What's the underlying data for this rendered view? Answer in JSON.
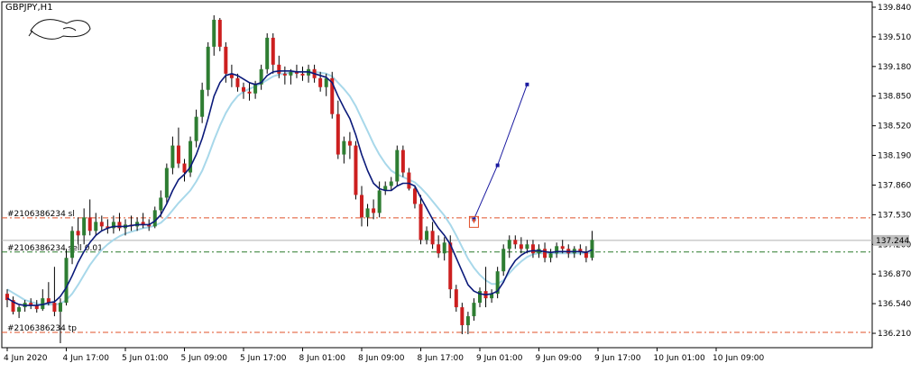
{
  "window": {
    "symbol_title": "GBPJPY,H1"
  },
  "colors": {
    "background": "#ffffff",
    "grid_frame": "#000000",
    "bull_candle": "#2e7d32",
    "bear_candle": "#cc1f1f",
    "fast_ma": "#0b1a7a",
    "slow_ma": "#a8d8ea",
    "order_sl_tp_line": "#e0502a",
    "order_entry_line": "#2a7a2a",
    "bid_line": "#b0b0b0",
    "price_label_bg": "#c0c0c0",
    "forecast_line": "#1a1aa0"
  },
  "chart_data": {
    "type": "candlestick",
    "title": "GBPJPY,H1",
    "ylim": [
      136.05,
      139.9
    ],
    "y_ticks": [
      "139.840",
      "139.510",
      "139.180",
      "138.850",
      "138.520",
      "138.190",
      "137.860",
      "137.530",
      "137.200",
      "136.870",
      "136.540",
      "136.210"
    ],
    "y_tick_values": [
      139.84,
      139.51,
      139.18,
      138.85,
      138.52,
      138.19,
      137.86,
      137.53,
      137.2,
      136.87,
      136.54,
      136.21
    ],
    "x_ticks": [
      "4 Jun 2020",
      "4 Jun 17:00",
      "5 Jun 01:00",
      "5 Jun 09:00",
      "5 Jun 17:00",
      "8 Jun 01:00",
      "8 Jun 09:00",
      "8 Jun 17:00",
      "9 Jun 01:00",
      "9 Jun 09:00",
      "9 Jun 17:00",
      "10 Jun 01:00",
      "10 Jun 09:00"
    ],
    "x_tick_bar_index": [
      0,
      10,
      20,
      30,
      40,
      50,
      60,
      70,
      80,
      90,
      100,
      110,
      120
    ],
    "current_price": 137.244,
    "current_price_label": "137.244",
    "horizontal_lines": [
      {
        "label": "#2106386234 sl",
        "value": 137.495,
        "kind": "sl"
      },
      {
        "label": "#2106386234 sell 0.01",
        "value": 137.115,
        "kind": "entry"
      },
      {
        "label": "#2106386234 tp",
        "value": 136.22,
        "kind": "tp"
      }
    ],
    "ohlc": [
      [
        136.65,
        136.7,
        136.5,
        136.58
      ],
      [
        136.58,
        136.62,
        136.42,
        136.45
      ],
      [
        136.45,
        136.52,
        136.38,
        136.5
      ],
      [
        136.5,
        136.58,
        136.45,
        136.55
      ],
      [
        136.55,
        136.6,
        136.48,
        136.52
      ],
      [
        136.52,
        136.58,
        136.44,
        136.48
      ],
      [
        136.48,
        136.7,
        136.46,
        136.6
      ],
      [
        136.6,
        136.78,
        136.52,
        136.55
      ],
      [
        136.55,
        136.95,
        136.4,
        136.45
      ],
      [
        136.45,
        136.6,
        136.1,
        136.55
      ],
      [
        136.55,
        137.15,
        136.52,
        137.05
      ],
      [
        137.05,
        137.4,
        136.98,
        137.35
      ],
      [
        137.35,
        137.5,
        137.2,
        137.3
      ],
      [
        137.3,
        137.6,
        137.2,
        137.5
      ],
      [
        137.5,
        137.7,
        137.3,
        137.35
      ],
      [
        137.35,
        137.55,
        137.3,
        137.45
      ],
      [
        137.45,
        137.52,
        137.35,
        137.4
      ],
      [
        137.4,
        137.48,
        137.32,
        137.38
      ],
      [
        137.38,
        137.52,
        137.32,
        137.45
      ],
      [
        137.45,
        137.55,
        137.35,
        137.38
      ],
      [
        137.38,
        137.48,
        137.3,
        137.42
      ],
      [
        137.42,
        137.52,
        137.35,
        137.4
      ],
      [
        137.4,
        137.5,
        137.35,
        137.45
      ],
      [
        137.45,
        137.55,
        137.38,
        137.42
      ],
      [
        137.42,
        137.48,
        137.35,
        137.4
      ],
      [
        137.4,
        137.62,
        137.38,
        137.58
      ],
      [
        137.58,
        137.8,
        137.5,
        137.72
      ],
      [
        137.72,
        138.1,
        137.65,
        138.05
      ],
      [
        138.05,
        138.4,
        137.98,
        138.3
      ],
      [
        138.3,
        138.5,
        138.05,
        138.1
      ],
      [
        138.1,
        138.15,
        137.9,
        138.0
      ],
      [
        138.0,
        138.4,
        137.95,
        138.35
      ],
      [
        138.35,
        138.7,
        138.28,
        138.62
      ],
      [
        138.62,
        139.0,
        138.55,
        138.92
      ],
      [
        138.92,
        139.45,
        138.85,
        139.4
      ],
      [
        139.4,
        139.75,
        139.3,
        139.7
      ],
      [
        139.7,
        139.72,
        139.35,
        139.4
      ],
      [
        139.4,
        139.45,
        139.0,
        139.1
      ],
      [
        139.1,
        139.2,
        138.95,
        139.05
      ],
      [
        139.05,
        139.1,
        138.9,
        138.95
      ],
      [
        138.95,
        139.0,
        138.82,
        138.9
      ],
      [
        138.9,
        139.0,
        138.8,
        138.88
      ],
      [
        138.88,
        139.02,
        138.82,
        138.98
      ],
      [
        138.98,
        139.2,
        138.92,
        139.15
      ],
      [
        139.15,
        139.55,
        139.1,
        139.5
      ],
      [
        139.5,
        139.55,
        139.1,
        139.2
      ],
      [
        139.2,
        139.3,
        139.05,
        139.1
      ],
      [
        139.1,
        139.18,
        138.98,
        139.08
      ],
      [
        139.08,
        139.15,
        138.98,
        139.12
      ],
      [
        139.12,
        139.2,
        139.05,
        139.1
      ],
      [
        139.1,
        139.18,
        139.02,
        139.08
      ],
      [
        139.08,
        139.2,
        139.0,
        139.15
      ],
      [
        139.15,
        139.2,
        139.0,
        139.05
      ],
      [
        139.05,
        139.12,
        138.9,
        138.95
      ],
      [
        138.95,
        139.1,
        138.85,
        139.05
      ],
      [
        139.05,
        139.12,
        138.6,
        138.65
      ],
      [
        138.65,
        138.8,
        138.15,
        138.2
      ],
      [
        138.2,
        138.4,
        138.1,
        138.35
      ],
      [
        138.35,
        138.45,
        138.15,
        138.3
      ],
      [
        138.3,
        138.35,
        137.7,
        137.75
      ],
      [
        137.75,
        137.85,
        137.4,
        137.5
      ],
      [
        137.5,
        137.65,
        137.4,
        137.6
      ],
      [
        137.6,
        137.7,
        137.48,
        137.55
      ],
      [
        137.55,
        137.9,
        137.5,
        137.8
      ],
      [
        137.8,
        137.9,
        137.75,
        137.85
      ],
      [
        137.85,
        137.95,
        137.8,
        137.9
      ],
      [
        137.9,
        138.3,
        137.85,
        138.25
      ],
      [
        138.25,
        138.3,
        137.95,
        138.0
      ],
      [
        138.0,
        138.05,
        137.8,
        137.82
      ],
      [
        137.82,
        137.85,
        137.6,
        137.65
      ],
      [
        137.65,
        137.75,
        137.2,
        137.25
      ],
      [
        137.25,
        137.4,
        137.2,
        137.35
      ],
      [
        137.35,
        137.45,
        137.15,
        137.2
      ],
      [
        137.2,
        137.3,
        137.05,
        137.1
      ],
      [
        137.1,
        137.28,
        137.02,
        137.22
      ],
      [
        137.22,
        137.3,
        136.6,
        136.7
      ],
      [
        136.7,
        136.75,
        136.45,
        136.5
      ],
      [
        136.5,
        136.55,
        136.2,
        136.3
      ],
      [
        136.3,
        136.45,
        136.2,
        136.4
      ],
      [
        136.4,
        136.6,
        136.35,
        136.55
      ],
      [
        136.55,
        136.72,
        136.5,
        136.68
      ],
      [
        136.68,
        136.95,
        136.5,
        136.6
      ],
      [
        136.6,
        136.7,
        136.55,
        136.65
      ],
      [
        136.65,
        136.95,
        136.6,
        136.9
      ],
      [
        136.9,
        137.2,
        136.85,
        137.15
      ],
      [
        137.15,
        137.3,
        137.05,
        137.25
      ],
      [
        137.25,
        137.3,
        137.15,
        137.2
      ],
      [
        137.2,
        137.28,
        137.1,
        137.15
      ],
      [
        137.15,
        137.25,
        137.1,
        137.2
      ],
      [
        137.2,
        137.25,
        137.05,
        137.1
      ],
      [
        137.1,
        137.2,
        137.05,
        137.15
      ],
      [
        137.15,
        137.22,
        137.0,
        137.05
      ],
      [
        137.05,
        137.15,
        137.0,
        137.1
      ],
      [
        137.1,
        137.22,
        137.05,
        137.18
      ],
      [
        137.18,
        137.25,
        137.1,
        137.15
      ],
      [
        137.15,
        137.2,
        137.05,
        137.1
      ],
      [
        137.1,
        137.18,
        137.05,
        137.15
      ],
      [
        137.15,
        137.2,
        137.08,
        137.12
      ],
      [
        137.12,
        137.18,
        137.0,
        137.05
      ],
      [
        137.05,
        137.35,
        137.02,
        137.25
      ]
    ],
    "fast_ma": [
      136.6,
      136.56,
      136.53,
      136.52,
      136.52,
      136.52,
      136.53,
      136.55,
      136.56,
      136.62,
      136.72,
      136.85,
      137.0,
      137.12,
      137.22,
      137.3,
      137.35,
      137.38,
      137.4,
      137.4,
      137.4,
      137.41,
      137.42,
      137.42,
      137.42,
      137.46,
      137.53,
      137.65,
      137.8,
      137.92,
      137.98,
      138.06,
      138.2,
      138.38,
      138.6,
      138.85,
      139.0,
      139.08,
      139.1,
      139.08,
      139.04,
      139.0,
      138.98,
      139.0,
      139.08,
      139.12,
      139.13,
      139.13,
      139.13,
      139.12,
      139.12,
      139.12,
      139.1,
      139.08,
      139.06,
      139.0,
      138.85,
      138.72,
      138.6,
      138.42,
      138.2,
      138.02,
      137.88,
      137.82,
      137.8,
      137.8,
      137.85,
      137.88,
      137.88,
      137.85,
      137.72,
      137.6,
      137.48,
      137.38,
      137.3,
      137.2,
      137.05,
      136.9,
      136.75,
      136.68,
      136.65,
      136.64,
      136.65,
      136.68,
      136.78,
      136.92,
      137.02,
      137.08,
      137.12,
      137.13,
      137.13,
      137.12,
      137.11,
      137.12,
      137.12,
      137.12,
      137.12,
      137.12,
      137.11,
      137.14
    ],
    "slow_ma": [
      136.7,
      136.66,
      136.62,
      136.58,
      136.56,
      136.54,
      136.53,
      136.53,
      136.53,
      136.54,
      136.58,
      136.65,
      136.75,
      136.86,
      136.97,
      137.06,
      137.14,
      137.2,
      137.25,
      137.29,
      137.32,
      137.34,
      137.36,
      137.38,
      137.39,
      137.41,
      137.44,
      137.5,
      137.58,
      137.66,
      137.73,
      137.8,
      137.9,
      138.02,
      138.18,
      138.36,
      138.52,
      138.66,
      138.77,
      138.85,
      138.9,
      138.93,
      138.96,
      138.99,
      139.03,
      139.07,
      139.09,
      139.1,
      139.11,
      139.12,
      139.12,
      139.12,
      139.12,
      139.11,
      139.1,
      139.07,
      139.0,
      138.93,
      138.85,
      138.74,
      138.6,
      138.46,
      138.32,
      138.2,
      138.1,
      138.02,
      137.98,
      137.95,
      137.92,
      137.89,
      137.83,
      137.76,
      137.68,
      137.6,
      137.52,
      137.42,
      137.3,
      137.17,
      137.04,
      136.94,
      136.86,
      136.8,
      136.76,
      136.76,
      136.8,
      136.88,
      136.95,
      137.01,
      137.06,
      137.09,
      137.1,
      137.1,
      137.1,
      137.1,
      137.1,
      137.1,
      137.1,
      137.1,
      137.1,
      137.11
    ],
    "forecast_points": [
      {
        "bar": 79,
        "price": 137.48
      },
      {
        "bar": 83,
        "price": 138.08
      },
      {
        "bar": 88,
        "price": 138.98
      }
    ],
    "sell_marker": {
      "bar": 79,
      "price": 137.5
    }
  }
}
